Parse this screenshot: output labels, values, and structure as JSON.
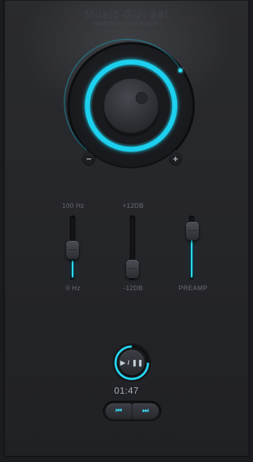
{
  "header": {
    "title": "Music GUI set",
    "subtitle": "www.borisvwick.com"
  },
  "knob": {
    "min_label": "−",
    "max_label": "+",
    "accent": "#22d6f2"
  },
  "sliders": [
    {
      "top_label": "100 Hz",
      "bottom_label": "0 Hz",
      "level": 0.25
    },
    {
      "top_label": "+12DB",
      "bottom_label": "-12DB",
      "level": 0.05
    },
    {
      "top_label": "",
      "bottom_label": "PREAMP",
      "level": 0.75
    }
  ],
  "player": {
    "play_pause_label": "▶ / ❚❚",
    "time": "01:47",
    "prev_icon": "⏮",
    "next_icon": "⏭"
  }
}
